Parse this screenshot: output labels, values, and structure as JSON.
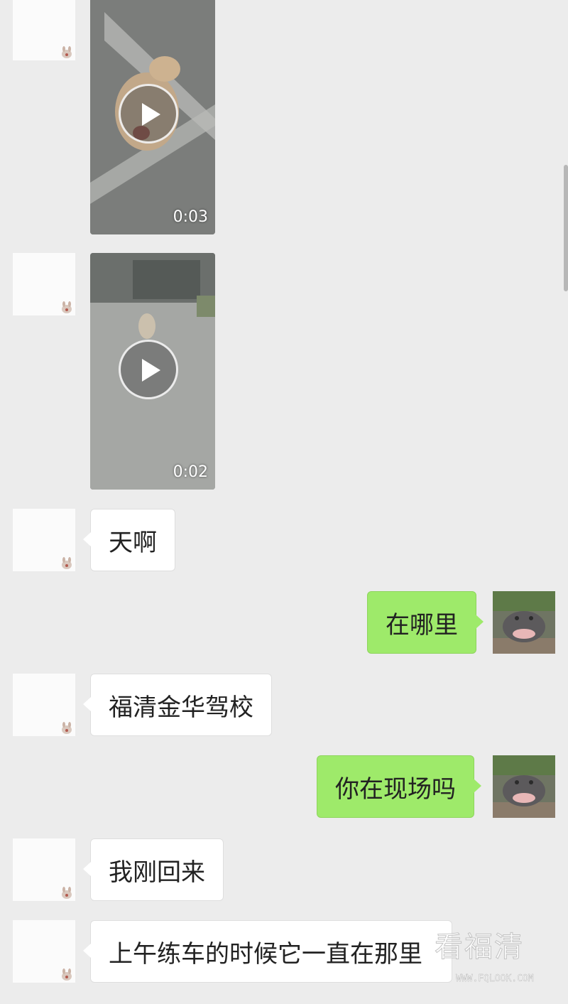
{
  "messages": [
    {
      "kind": "video",
      "side": "in",
      "duration": "0:03"
    },
    {
      "kind": "video",
      "side": "in",
      "duration": "0:02"
    },
    {
      "kind": "text",
      "side": "in",
      "text": "天啊"
    },
    {
      "kind": "text",
      "side": "out",
      "text": "在哪里"
    },
    {
      "kind": "text",
      "side": "in",
      "text": "福清金华驾校"
    },
    {
      "kind": "text",
      "side": "out",
      "text": "你在现场吗"
    },
    {
      "kind": "text",
      "side": "in",
      "text": "我刚回来"
    },
    {
      "kind": "text",
      "side": "in",
      "text": "上午练车的时候它一直在那里"
    }
  ],
  "watermark": {
    "text": "看福清",
    "url": "WWW.FQLOOK.COM"
  },
  "colors": {
    "background": "#ececec",
    "incoming_bubble": "#ffffff",
    "outgoing_bubble": "#9eea6a"
  },
  "icons": {
    "play": "play-icon",
    "avatar_badge": "rabbit-sticker-icon"
  }
}
